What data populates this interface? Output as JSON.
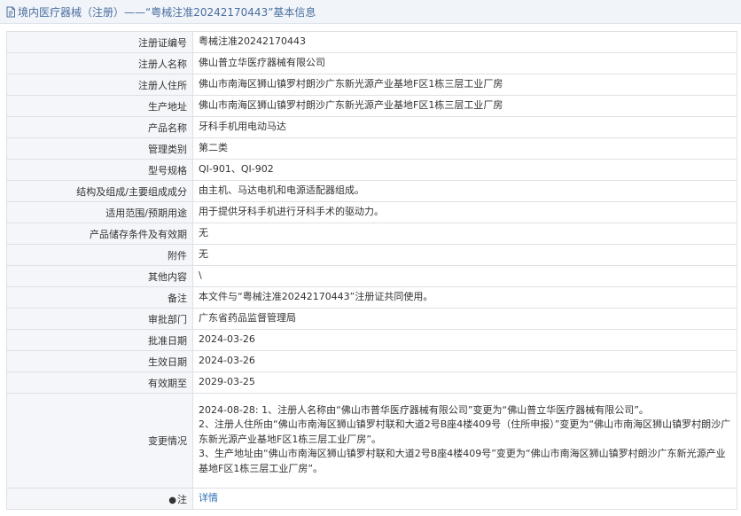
{
  "header": {
    "title": "境内医疗器械（注册）——“粤械注准20242170443”基本信息"
  },
  "rows": [
    {
      "label": "注册证编号",
      "value": "粤械注准20242170443"
    },
    {
      "label": "注册人名称",
      "value": "佛山普立华医疗器械有限公司"
    },
    {
      "label": "注册人住所",
      "value": "佛山市南海区狮山镇罗村朗沙广东新光源产业基地F区1栋三层工业厂房"
    },
    {
      "label": "生产地址",
      "value": "佛山市南海区狮山镇罗村朗沙广东新光源产业基地F区1栋三层工业厂房"
    },
    {
      "label": "产品名称",
      "value": "牙科手机用电动马达"
    },
    {
      "label": "管理类别",
      "value": "第二类"
    },
    {
      "label": "型号规格",
      "value": "QI-901、QI-902"
    },
    {
      "label": "结构及组成/主要组成成分",
      "value": "由主机、马达电机和电源适配器组成。"
    },
    {
      "label": "适用范围/预期用途",
      "value": "用于提供牙科手机进行牙科手术的驱动力。"
    },
    {
      "label": "产品储存条件及有效期",
      "value": "无"
    },
    {
      "label": "附件",
      "value": "无"
    },
    {
      "label": "其他内容",
      "value": "\\"
    },
    {
      "label": "备注",
      "value": "本文件与“粤械注准20242170443”注册证共同使用。"
    },
    {
      "label": "审批部门",
      "value": "广东省药品监督管理局"
    },
    {
      "label": "批准日期",
      "value": "2024-03-26"
    },
    {
      "label": "生效日期",
      "value": "2024-03-26"
    },
    {
      "label": "有效期至",
      "value": "2029-03-25"
    }
  ],
  "changes": {
    "label": "变更情况",
    "value": "2024-08-28: 1、注册人名称由“佛山市普华医疗器械有限公司”变更为“佛山普立华医疗器械有限公司”。\n2、注册人住所由“佛山市南海区狮山镇罗村联和大道2号B座4楼409号（住所申报）”变更为“佛山市南海区狮山镇罗村朗沙广东新光源产业基地F区1栋三层工业厂房”。\n3、生产地址由“佛山市南海区狮山镇罗村联和大道2号B座4楼409号”变更为“佛山市南海区狮山镇罗村朗沙广东新光源产业基地F区1栋三层工业厂房”。"
  },
  "footer_row": {
    "label": "注",
    "link": "详情"
  },
  "colors": {
    "title": "#4a6f9f",
    "link": "#2f6fb5",
    "label_bg": "#f4f6f9",
    "border": "#dde1e6"
  },
  "icons": {
    "title": "document-icon",
    "footer": "pin-icon"
  }
}
